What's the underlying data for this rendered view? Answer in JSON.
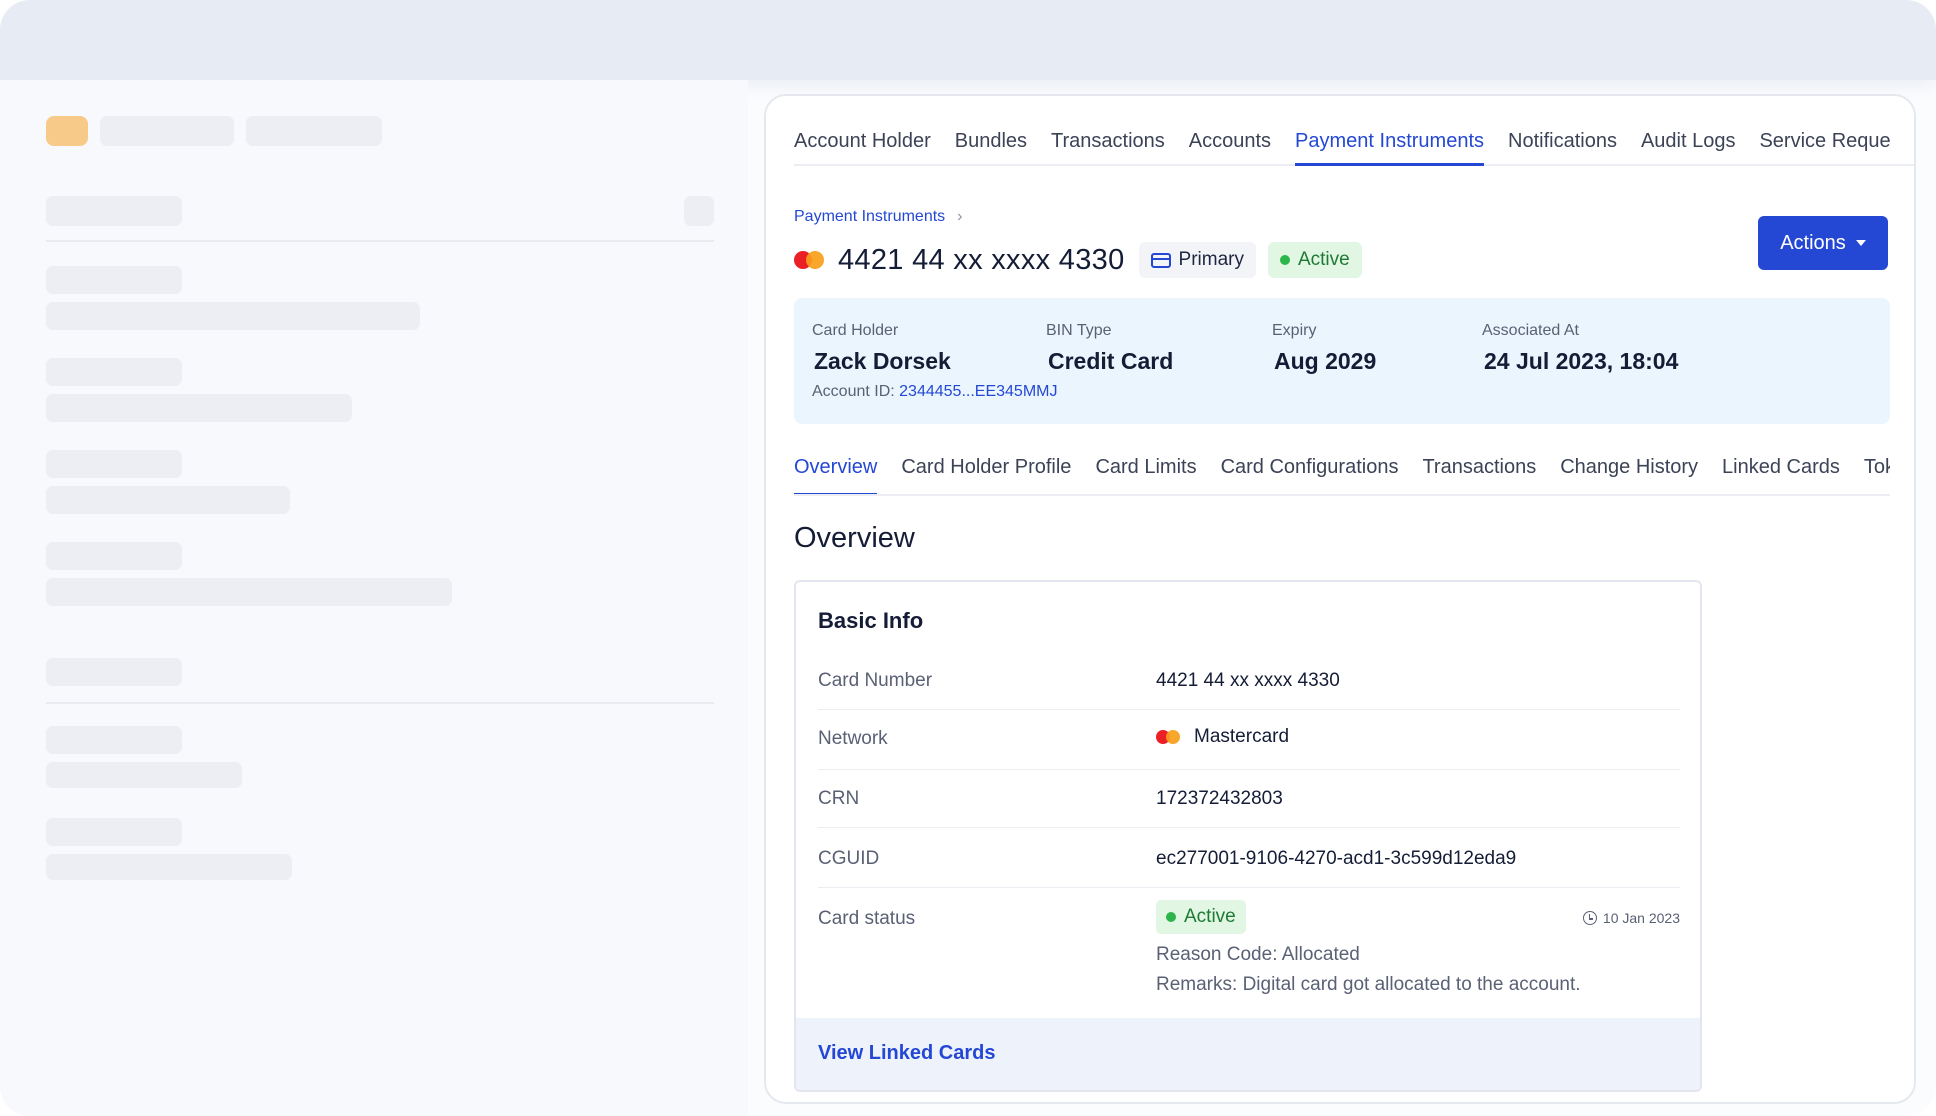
{
  "top_tabs": [
    "Account Holder",
    "Bundles",
    "Transactions",
    "Accounts",
    "Payment Instruments",
    "Notifications",
    "Audit Logs",
    "Service Reque"
  ],
  "active_top_tab": "Payment Instruments",
  "breadcrumb": {
    "label": "Payment Instruments",
    "separator": "›"
  },
  "card": {
    "number": "4421 44 xx xxxx 4330",
    "network_icon": "mastercard-icon",
    "primary_badge": "Primary",
    "status_badge": "Active"
  },
  "actions_button": {
    "label": "Actions"
  },
  "summary": {
    "card_holder_label": "Card Holder",
    "card_holder_value": "Zack Dorsek",
    "account_id_label": "Account ID:",
    "account_id_value": "2344455...EE345MMJ",
    "bin_type_label": "BIN Type",
    "bin_type_value": "Credit Card",
    "expiry_label": "Expiry",
    "expiry_value": "Aug 2029",
    "associated_label": "Associated At",
    "associated_value": "24 Jul 2023, 18:04"
  },
  "sub_tabs": [
    "Overview",
    "Card Holder Profile",
    "Card Limits",
    "Card Configurations",
    "Transactions",
    "Change History",
    "Linked Cards",
    "Toke"
  ],
  "active_sub_tab": "Overview",
  "section_title": "Overview",
  "basic_info": {
    "title": "Basic Info",
    "card_number_label": "Card Number",
    "card_number_value": "4421 44 xx xxxx 4330",
    "network_label": "Network",
    "network_value": "Mastercard",
    "crn_label": "CRN",
    "crn_value": "172372432803",
    "cguid_label": "CGUID",
    "cguid_value": "ec277001-9106-4270-acd1-3c599d12eda9",
    "status_label": "Card status",
    "status_value": "Active",
    "status_date": "10 Jan 2023",
    "reason_code": "Reason Code: Allocated",
    "remarks": "Remarks: Digital card got allocated to the account.",
    "footer_link": "View Linked Cards"
  },
  "colors": {
    "accent": "#2448d4",
    "active_green": "#2bb54a",
    "summary_bg": "#eaf5fd"
  }
}
